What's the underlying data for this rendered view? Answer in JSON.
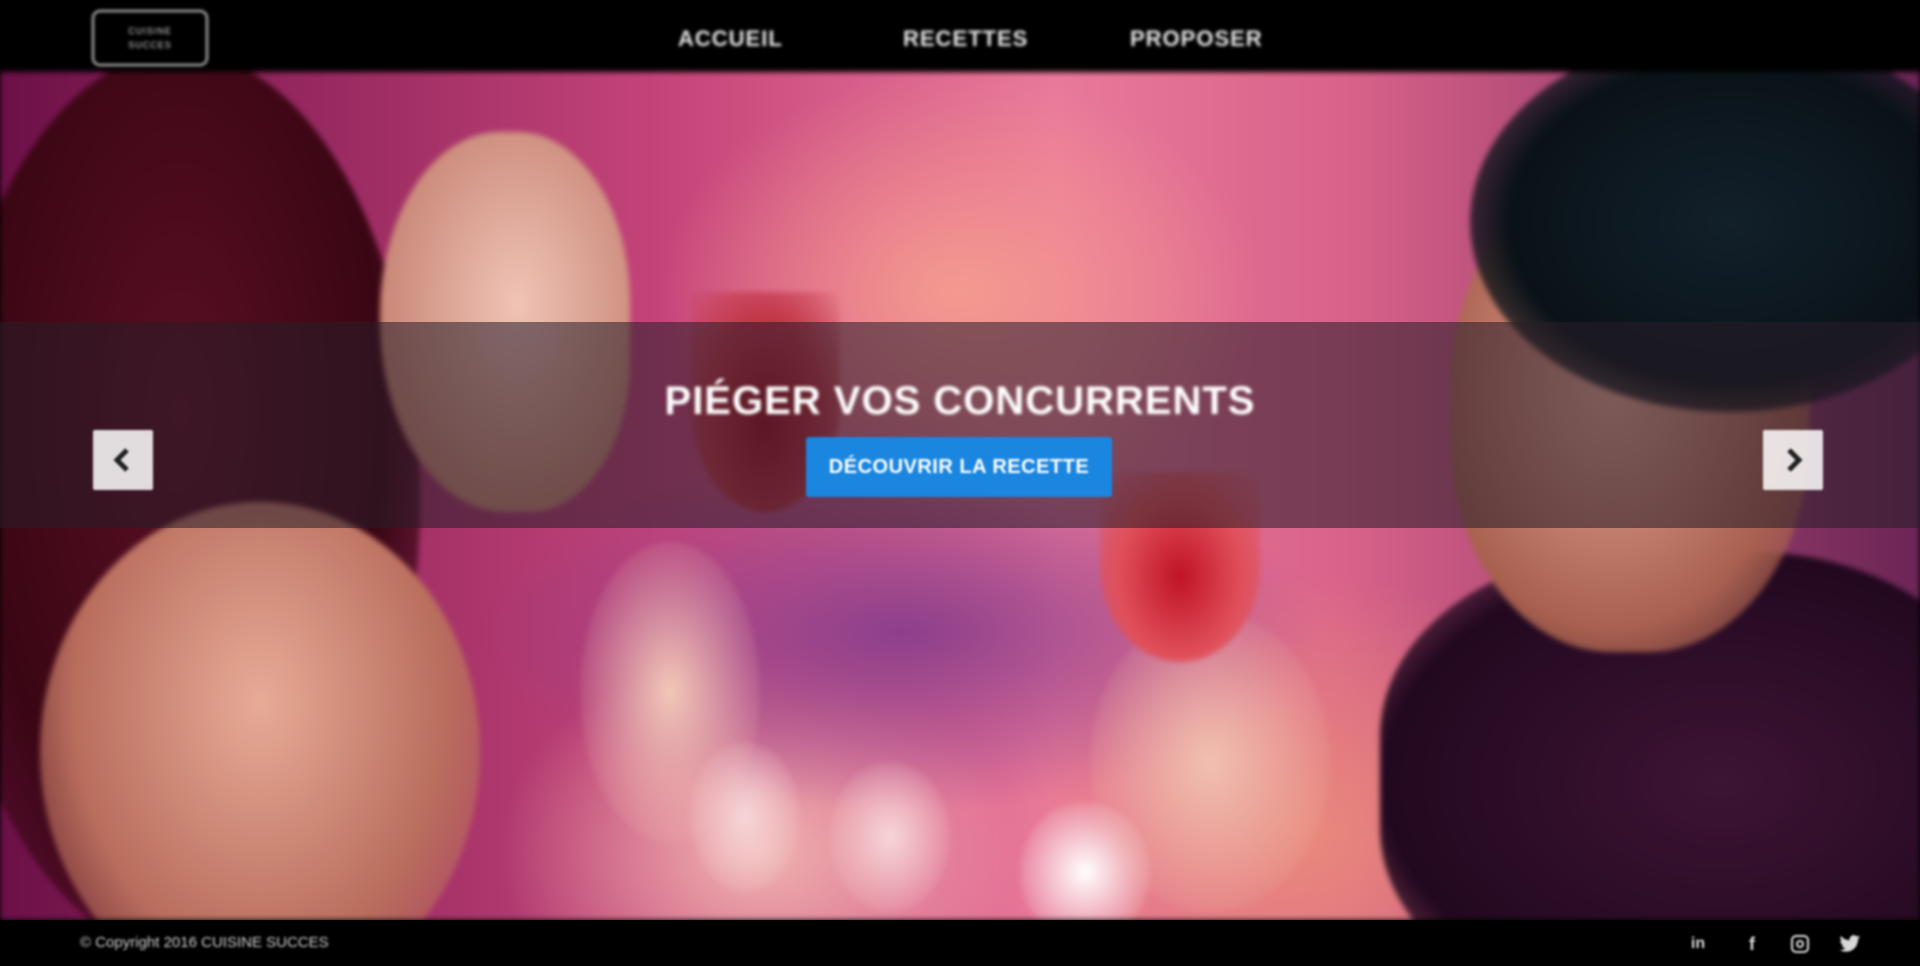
{
  "logo": {
    "line1": "CUISINE",
    "line2": "SUCCES"
  },
  "nav": {
    "items": [
      {
        "label": "ACCUEIL"
      },
      {
        "label": "RECETTES"
      },
      {
        "label": "PROPOSER"
      }
    ]
  },
  "hero": {
    "title": "PIÉGER VOS CONCURRENTS",
    "button_label": "DÉCOUVRIR LA RECETTE",
    "prev_icon": "chevron-left-icon",
    "next_icon": "chevron-right-icon"
  },
  "footer": {
    "copyright": "© Copyright 2016 CUISINE SUCCES",
    "social": [
      {
        "name": "linkedin-icon",
        "glyph": "in"
      },
      {
        "name": "facebook-icon",
        "glyph": "f"
      },
      {
        "name": "instagram-icon",
        "glyph": ""
      },
      {
        "name": "twitter-icon",
        "glyph": "🐦"
      }
    ]
  },
  "colors": {
    "background": "#000000",
    "accent": "#1a86e0",
    "text": "#ffffff"
  }
}
